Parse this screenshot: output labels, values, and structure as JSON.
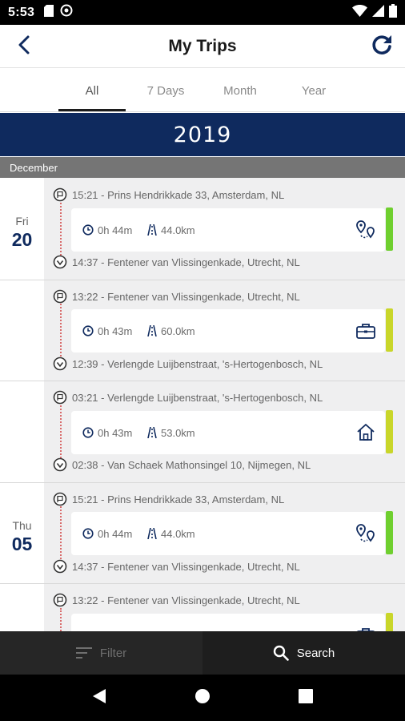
{
  "status_bar": {
    "time": "5:53"
  },
  "header": {
    "title": "My Trips"
  },
  "tabs": [
    {
      "label": "All",
      "active": true
    },
    {
      "label": "7 Days",
      "active": false
    },
    {
      "label": "Month",
      "active": false
    },
    {
      "label": "Year",
      "active": false
    }
  ],
  "year": "2019",
  "month": "December",
  "days": [
    {
      "day_name": "Fri",
      "day_num": "20"
    },
    {
      "day_name": "Thu",
      "day_num": "05"
    }
  ],
  "trips": [
    {
      "start_time": "15:21",
      "start_address": "Prins Hendrikkade 33, Amsterdam, NL",
      "duration": "0h 44m",
      "distance": "44.0km",
      "end_time": "14:37",
      "end_address": "Fentener van Vlissingenkade, Utrecht, NL",
      "purpose_icon": "map-route-icon",
      "score_color": "#6fcf2f"
    },
    {
      "start_time": "13:22",
      "start_address": "Fentener van Vlissingenkade, Utrecht, NL",
      "duration": "0h 43m",
      "distance": "60.0km",
      "end_time": "12:39",
      "end_address": "Verlengde Luijbenstraat, 's-Hertogenbosch, NL",
      "purpose_icon": "briefcase-icon",
      "score_color": "#c9d62a"
    },
    {
      "start_time": "03:21",
      "start_address": "Verlengde Luijbenstraat, 's-Hertogenbosch, NL",
      "duration": "0h 43m",
      "distance": "53.0km",
      "end_time": "02:38",
      "end_address": "Van Schaek Mathonsingel 10, Nijmegen, NL",
      "purpose_icon": "home-icon",
      "score_color": "#c9d62a"
    },
    {
      "start_time": "15:21",
      "start_address": "Prins Hendrikkade 33, Amsterdam, NL",
      "duration": "0h 44m",
      "distance": "44.0km",
      "end_time": "14:37",
      "end_address": "Fentener van Vlissingenkade, Utrecht, NL",
      "purpose_icon": "map-route-icon",
      "score_color": "#6fcf2f"
    },
    {
      "start_time": "13:22",
      "start_address": "Fentener van Vlissingenkade, Utrecht, NL",
      "purpose_icon": "briefcase-icon",
      "score_color": "#c9d62a"
    }
  ],
  "bottom": {
    "filter_label": "Filter",
    "search_label": "Search"
  },
  "colors": {
    "navy": "#0f2a5e",
    "green": "#6fcf2f",
    "yellow_green": "#c9d62a"
  }
}
